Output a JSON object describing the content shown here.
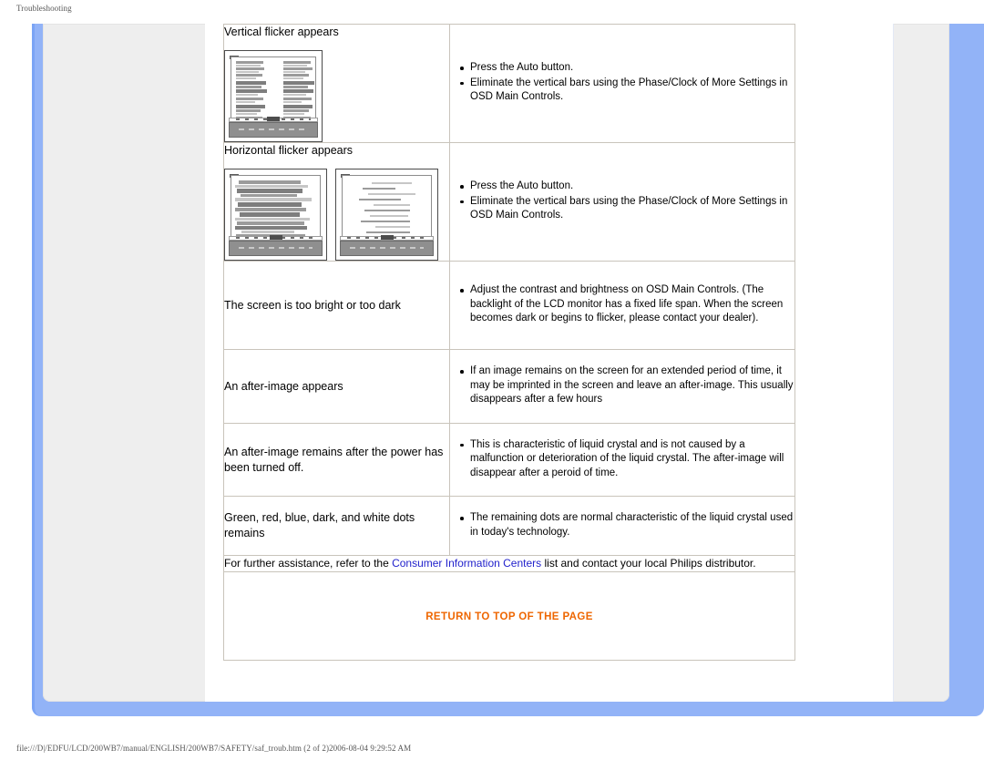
{
  "page": {
    "header_label": "Troubleshooting",
    "footer_path": "file:///D|/EDFU/LCD/200WB7/manual/ENGLISH/200WB7/SAFETY/saf_troub.htm (2 of 2)2006-08-04 9:29:52 AM"
  },
  "colors": {
    "frame_blue": "#92b3f7",
    "sheet_grey": "#eeeeee",
    "table_border": "#c9c4bb",
    "link_blue": "#2222cc",
    "return_orange": "#ee6600"
  },
  "table": {
    "rows": [
      {
        "symptom": "Vertical flicker appears",
        "has_image": true,
        "image_count": 1,
        "image_kind": "vertical-flicker-monitor",
        "fixes": [
          "Press the Auto button.",
          "Eliminate the vertical bars using the Phase/Clock of More Settings in OSD Main Controls."
        ]
      },
      {
        "symptom": "Horizontal flicker appears",
        "has_image": true,
        "image_count": 2,
        "image_kind": "horizontal-flicker-monitor",
        "fixes": [
          "Press the Auto button.",
          "Eliminate the vertical bars using the Phase/Clock of More Settings in OSD Main Controls."
        ]
      },
      {
        "symptom": "The screen is too bright or too dark",
        "has_image": false,
        "image_count": 0,
        "image_kind": "",
        "fixes": [
          "Adjust the contrast and brightness on OSD Main Controls. (The backlight of the LCD monitor has a fixed life span. When the screen becomes dark or begins to flicker, please contact your dealer)."
        ]
      },
      {
        "symptom": "An after-image appears",
        "has_image": false,
        "image_count": 0,
        "image_kind": "",
        "fixes": [
          "If an image remains on the screen for an extended period of time, it may be imprinted in the screen and leave an after-image. This usually disappears after a few hours"
        ]
      },
      {
        "symptom": "An after-image remains after the power has been turned off.",
        "has_image": false,
        "image_count": 0,
        "image_kind": "",
        "fixes": [
          "This is characteristic of liquid crystal and is not caused by a malfunction or deterioration of the liquid crystal. The after-image will disappear after a peroid of time."
        ]
      },
      {
        "symptom": "Green, red, blue, dark, and white dots remains",
        "has_image": false,
        "image_count": 0,
        "image_kind": "",
        "fixes": [
          "The remaining dots are normal characteristic of the liquid crystal used in today's technology."
        ]
      }
    ],
    "assistance": {
      "before_link": "For further assistance, refer to the ",
      "link_text": "Consumer Information Centers",
      "after_link": " list and contact your local Philips distributor."
    },
    "return_link": "RETURN TO TOP OF THE PAGE"
  }
}
